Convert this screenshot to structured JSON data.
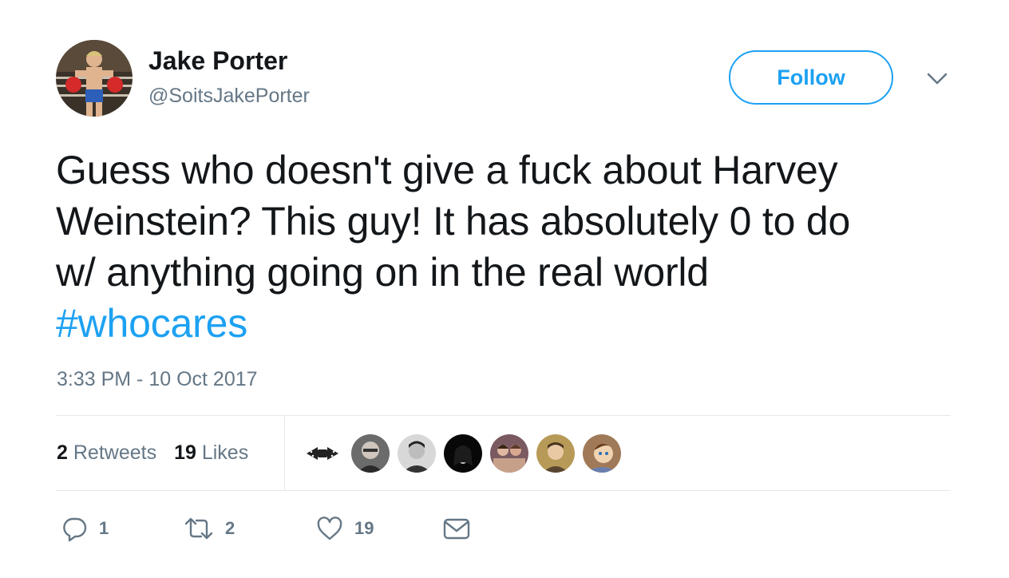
{
  "author": {
    "name": "Jake Porter",
    "handle": "@SoitsJakePorter",
    "avatar_icon": "boxer-avatar"
  },
  "follow_button": {
    "label": "Follow"
  },
  "menu": {
    "icon": "chevron-down-icon"
  },
  "tweet": {
    "lines": [
      "Guess who doesn't give a fuck about Harvey",
      "Weinstein? This guy! It has absolutely 0 to do",
      "w/ anything going on in the real world"
    ],
    "hashtag": "#whocares",
    "timestamp": "3:33 PM - 10 Oct 2017"
  },
  "stats": {
    "retweets_count": "2",
    "retweets_label": "Retweets",
    "likes_count": "19",
    "likes_label": "Likes"
  },
  "liked_by": [
    {
      "name": "bowtie-avatar"
    },
    {
      "name": "older-man-avatar"
    },
    {
      "name": "young-man-avatar"
    },
    {
      "name": "dark-portrait-avatar"
    },
    {
      "name": "group-photo-avatar"
    },
    {
      "name": "man-avatar"
    },
    {
      "name": "cartoon-avatar"
    }
  ],
  "actions": {
    "reply_count": "1",
    "retweet_count": "2",
    "like_count": "19"
  },
  "colors": {
    "accent": "#1da1f2",
    "text": "#14171a",
    "muted": "#657786",
    "divider": "#e1e8ed"
  }
}
